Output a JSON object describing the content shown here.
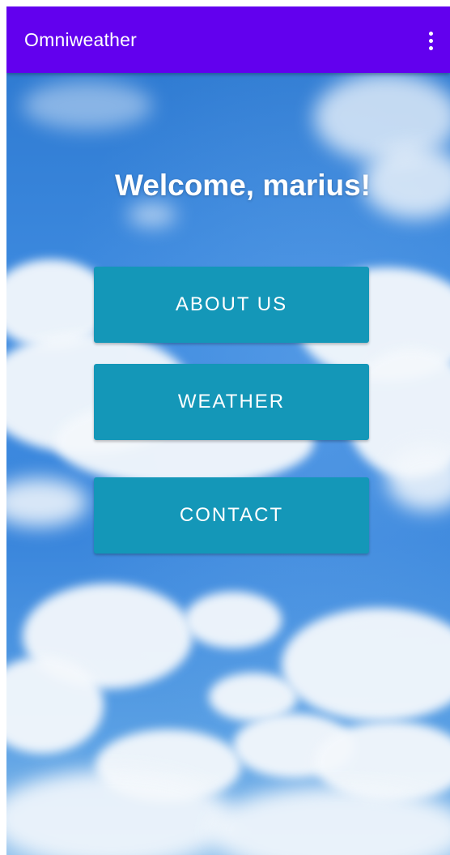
{
  "app_bar": {
    "title": "Omniweather",
    "background": "#6200ee",
    "menu_icon": "more-vert-icon"
  },
  "main": {
    "welcome_text": "Welcome, marius!",
    "button_color": "#1497b8",
    "buttons": [
      {
        "label": "ABOUT US"
      },
      {
        "label": "WEATHER"
      },
      {
        "label": "CONTACT"
      }
    ]
  }
}
